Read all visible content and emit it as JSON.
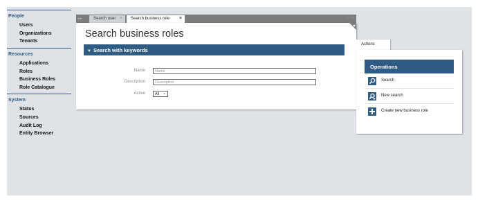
{
  "sidebar": {
    "sections": [
      {
        "title": "People",
        "items": [
          "Users",
          "Organizations",
          "Tenants"
        ]
      },
      {
        "title": "Resources",
        "items": [
          "Applications",
          "Roles",
          "Business Roles",
          "Role Catalogue"
        ]
      },
      {
        "title": "System",
        "items": [
          "Status",
          "Sources",
          "Audit Log",
          "Entity Browser"
        ]
      }
    ]
  },
  "tabs": {
    "nav_glyph": "◂ ▸",
    "items": [
      {
        "label": "Search user",
        "close": "×"
      },
      {
        "label": "Search business role",
        "close": "×"
      }
    ],
    "window_buttons": "▫ ▭"
  },
  "main": {
    "title": "Search business roles",
    "section_title": "Search with keywords",
    "fields": {
      "name": {
        "label": "Name",
        "placeholder": "Name"
      },
      "description": {
        "label": "Description",
        "placeholder": "Description"
      },
      "active": {
        "label": "Active",
        "value": "All",
        "chevron": "⌄"
      }
    }
  },
  "actions": {
    "tab_label": "Actions",
    "header": "Operations",
    "items": [
      {
        "label": "Search",
        "icon": "search-icon"
      },
      {
        "label": "New search",
        "icon": "new-search-icon"
      },
      {
        "label": "Create new business role",
        "icon": "plus-icon"
      }
    ]
  },
  "colors": {
    "accent": "#2f5c84",
    "background": "#dfe3e7",
    "tabbar": "#7a7c7e"
  }
}
